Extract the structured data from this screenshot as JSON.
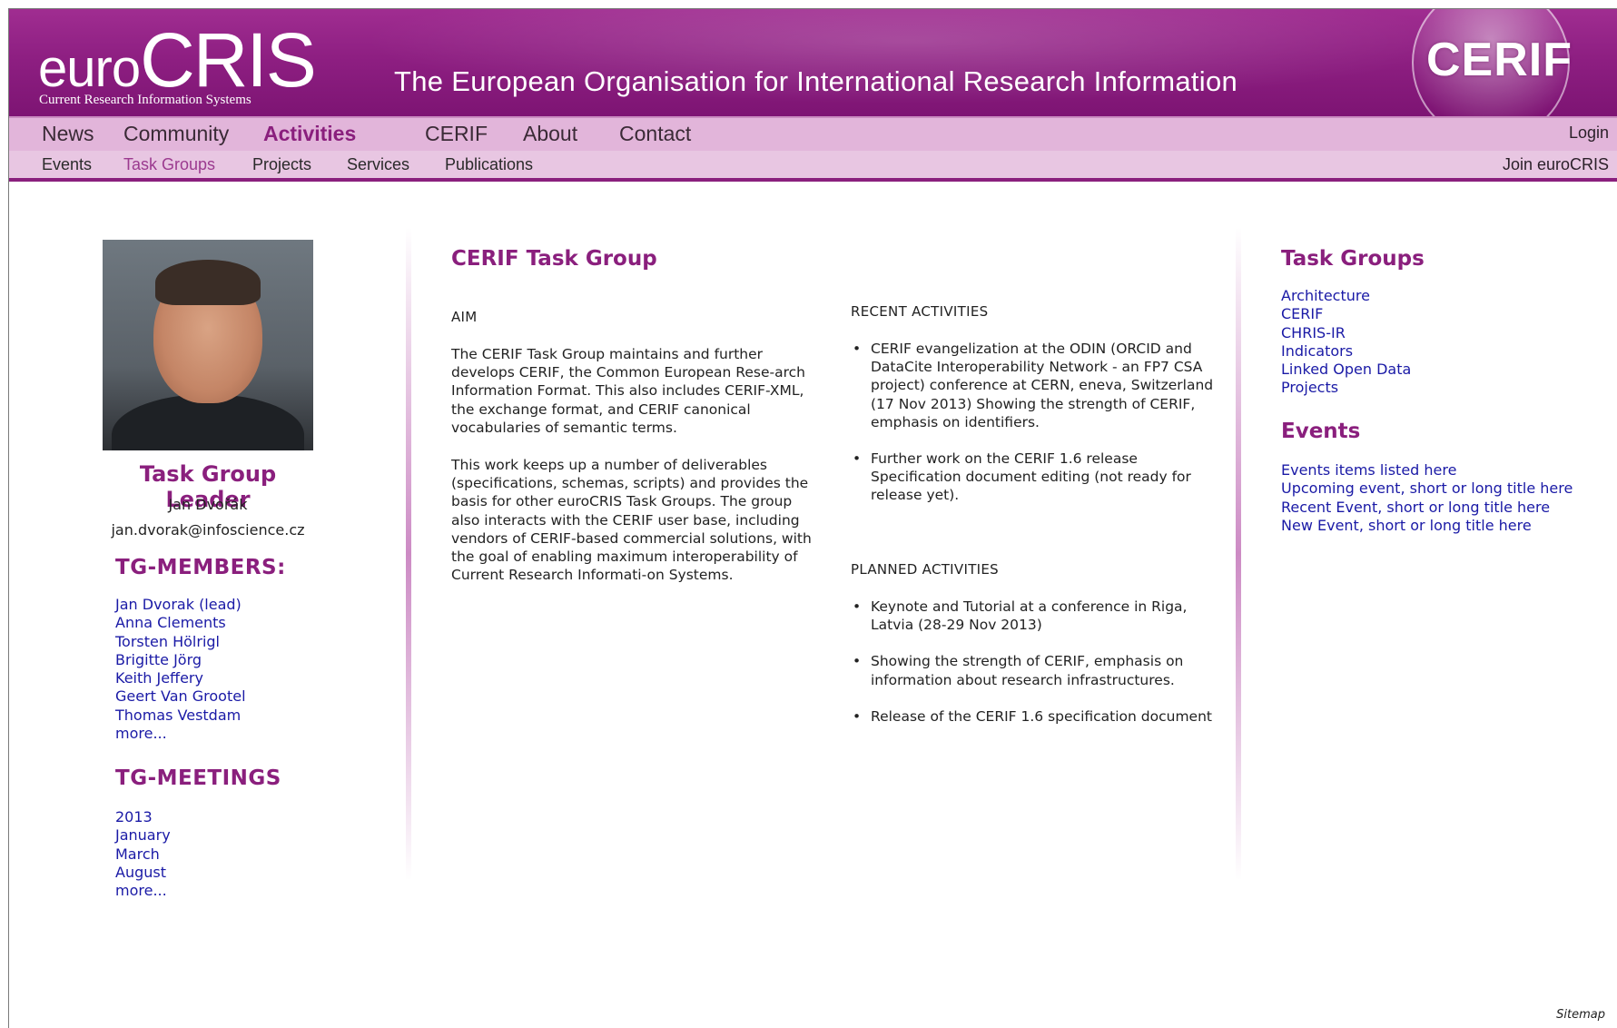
{
  "brand": {
    "logo_euro": "euro",
    "logo_cris": "CRIS",
    "logo_subtitle": "Current Research Information Systems",
    "tagline": "The European Organisation for International Research Information",
    "badge": "CERIF"
  },
  "nav_main": {
    "items": [
      {
        "label": "News"
      },
      {
        "label": "Community"
      },
      {
        "label": "Activities",
        "active": true
      },
      {
        "label": "CERIF"
      },
      {
        "label": "About"
      },
      {
        "label": "Contact"
      }
    ],
    "login": "Login"
  },
  "nav_sub": {
    "items": [
      {
        "label": "Events"
      },
      {
        "label": "Task Groups",
        "active": true
      },
      {
        "label": "Projects"
      },
      {
        "label": "Services"
      },
      {
        "label": "Publications"
      }
    ],
    "join": "Join euroCRIS"
  },
  "left": {
    "leader_heading": "Task Group Leader",
    "leader_name": "Jan Dvořák",
    "leader_email": "jan.dvorak@infoscience.cz",
    "members_heading": "TG-MEMBERS:",
    "members": [
      "Jan Dvorak (lead)",
      "Anna Clements",
      "Torsten Hölrigl",
      "Brigitte Jörg",
      "Keith Jeffery",
      "Geert Van Grootel",
      "Thomas Vestdam",
      "more..."
    ],
    "meetings_heading": "TG-MEETINGS",
    "meetings": [
      "2013",
      "January",
      "March",
      "August",
      "more..."
    ]
  },
  "main": {
    "title": "CERIF Task Group",
    "aim_label": "AIM",
    "aim_para1": "The CERIF Task Group maintains and further develops CERIF, the Common European Rese-arch Information Format. This also includes CERIF-XML, the exchange format, and CERIF canonical vocabularies of semantic terms.",
    "aim_para2": "This work keeps up a number of deliverables (specifications, schemas, scripts) and provides the basis for other euroCRIS Task Groups. The group also interacts with the CERIF user base, including vendors of CERIF-based commercial solutions, with the goal of enabling maximum interoperability of Current Research Informati-on Systems.",
    "recent_label": "RECENT ACTIVITIES",
    "recent": [
      "CERIF evangelization at the ODIN (ORCID and DataCite Interoperability Network - an FP7 CSA project) conference at CERN, eneva, Switzerland (17 Nov 2013) Showing the strength of CERIF, emphasis on identifiers.",
      "Further work on the CERIF 1.6 release Specification document editing (not ready for release yet)."
    ],
    "planned_label": "PLANNED ACTIVITIES",
    "planned": [
      "Keynote and Tutorial at a conference in Riga, Latvia (28-29 Nov 2013)",
      "Showing the strength of CERIF, emphasis on information about research infrastructures.",
      "Release of the CERIF 1.6 specification document"
    ]
  },
  "right": {
    "taskgroups_heading": "Task Groups",
    "taskgroups": [
      "Architecture",
      "CERIF",
      "CHRIS-IR",
      "Indicators",
      "Linked Open Data",
      "Projects"
    ],
    "events_heading": "Events",
    "events": [
      "Events items listed here",
      "Upcoming event, short or long title here",
      "Recent Event, short or long title here",
      "New Event, short or long title here"
    ]
  },
  "footer": {
    "sitemap": "Sitemap"
  },
  "colors": {
    "brand_purple": "#8a1f7d",
    "nav_bg": "#e2b5da",
    "link": "#1a1aa6"
  }
}
